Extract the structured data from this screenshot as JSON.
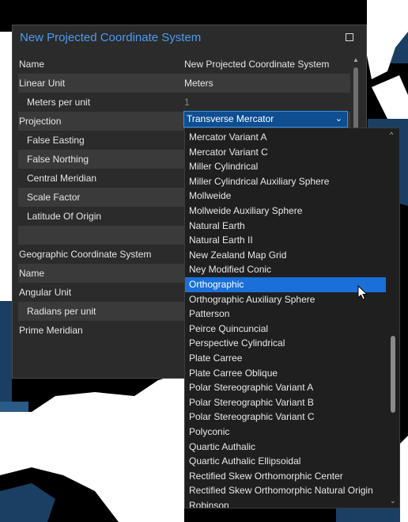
{
  "dialog": {
    "title": "New Projected Coordinate System"
  },
  "grid": {
    "rows": [
      {
        "name": "Name",
        "value": "New Projected Coordinate System"
      },
      {
        "name": "Linear Unit",
        "value": "Meters"
      },
      {
        "name": "Meters per unit",
        "value": "1"
      },
      {
        "name": "Projection",
        "value": "Transverse Mercator"
      },
      {
        "name": "False Easting",
        "value": ""
      },
      {
        "name": "False Northing",
        "value": ""
      },
      {
        "name": "Central Meridian",
        "value": ""
      },
      {
        "name": "Scale Factor",
        "value": ""
      },
      {
        "name": "Latitude Of Origin",
        "value": ""
      },
      {
        "name": "",
        "value": ""
      },
      {
        "name": "Geographic Coordinate System",
        "value": ""
      },
      {
        "name": "Name",
        "value": ""
      },
      {
        "name": "Angular Unit",
        "value": ""
      },
      {
        "name": "Radians per unit",
        "value": ""
      },
      {
        "name": "Prime Meridian",
        "value": ""
      }
    ]
  },
  "projection_dropdown": {
    "selected": "Orthographic",
    "options": [
      "Mercator Variant A",
      "Mercator Variant C",
      "Miller Cylindrical",
      "Miller Cylindrical Auxiliary Sphere",
      "Mollweide",
      "Mollweide Auxiliary Sphere",
      "Natural Earth",
      "Natural Earth II",
      "New Zealand Map Grid",
      "Ney Modified Conic",
      "Orthographic",
      "Orthographic Auxiliary Sphere",
      "Patterson",
      "Peirce Quincuncial",
      "Perspective Cylindrical",
      "Plate Carree",
      "Plate Carree Oblique",
      "Polar Stereographic Variant A",
      "Polar Stereographic Variant B",
      "Polar Stereographic Variant C",
      "Polyconic",
      "Quartic Authalic",
      "Quartic Authalic Ellipsoidal",
      "Rectified Skew Orthomorphic Center",
      "Rectified Skew Orthomorphic Natural Origin",
      "Robinson"
    ]
  },
  "colors": {
    "accent": "#4a9bf0",
    "selection": "#1a6fd8",
    "dialog_bg": "#2b2b2b",
    "ocean": "#1b3f63"
  },
  "icons": {
    "maximize": "maximize-icon",
    "chevron": "chevron-down-icon",
    "cursor": "mouse-pointer-icon"
  }
}
